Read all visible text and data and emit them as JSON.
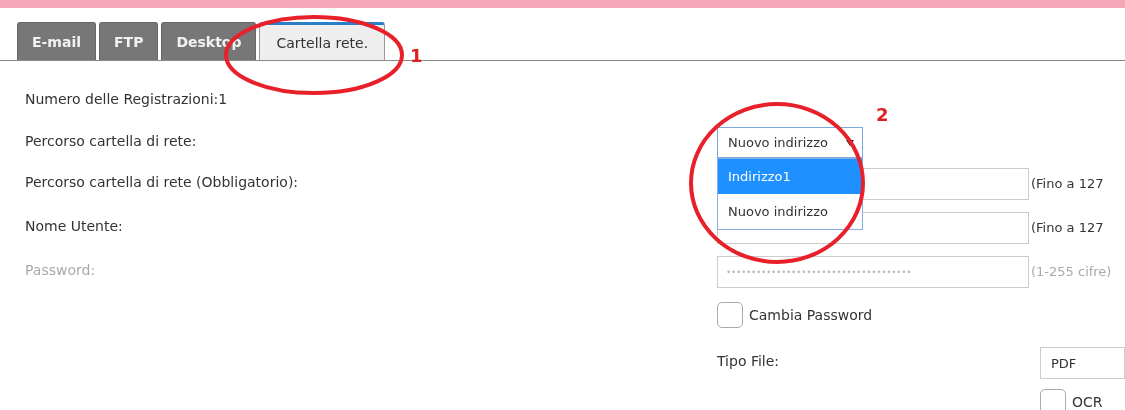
{
  "tabs": [
    {
      "label": "E-mail",
      "selected": false
    },
    {
      "label": "FTP",
      "selected": false
    },
    {
      "label": "Desktop",
      "selected": false
    },
    {
      "label": "Cartella rete.",
      "selected": true
    }
  ],
  "form": {
    "rows": [
      {
        "kind": "info",
        "label": "Numero delle Registrazioni:1"
      },
      {
        "kind": "select",
        "label": "Percorso cartella di rete:",
        "value": "Nuovo indirizzo",
        "expanded": true,
        "options": [
          {
            "label": "Indirizzo1",
            "highlighted": true
          },
          {
            "label": "Nuovo indirizzo",
            "highlighted": false
          }
        ]
      },
      {
        "kind": "input",
        "label": "Percorso cartella di rete (Obbligatorio):",
        "hint": "(Fino a 127",
        "disabled": false
      },
      {
        "kind": "input",
        "label": "Nome Utente:",
        "hint": "(Fino a 127",
        "disabled": false
      },
      {
        "kind": "password",
        "label": "Password:",
        "value": "•••••••••••••••••••••••••••••••••••••",
        "hint": "(1-255 cifre)",
        "disabled": true
      },
      {
        "kind": "checkbox",
        "label": "Cambia Password",
        "checked": false
      },
      {
        "kind": "filetype",
        "label": "Tipo File:",
        "value": "PDF"
      },
      {
        "kind": "checkbox-right",
        "label": "OCR",
        "checked": false
      }
    ]
  },
  "annotations": [
    {
      "label": "1"
    },
    {
      "label": "2"
    }
  ]
}
